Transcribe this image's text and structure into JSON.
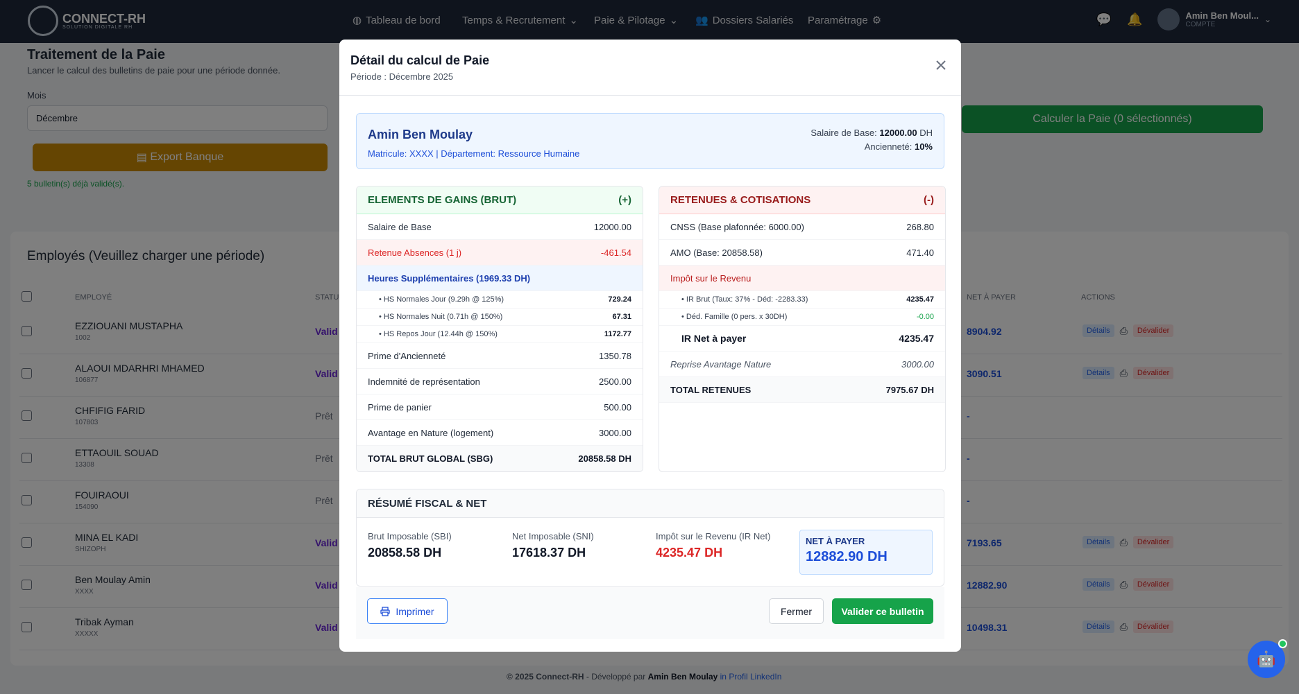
{
  "nav": {
    "brand": "CONNECT-RH",
    "brand_sub": "SOLUTION DIGITALE RH",
    "items": [
      "Tableau de bord",
      "Temps & Recrutement",
      "Paie & Pilotage",
      "Dossiers Salariés",
      "Paramétrage"
    ],
    "user_name": "Amin Ben Moul...",
    "user_role": "COMPTE"
  },
  "page": {
    "title": "Traitement de la Paie",
    "subtitle": "Lancer le calcul des bulletins de paie pour une période donnée.",
    "mois_label": "Mois",
    "mois_value": "Décembre",
    "export_label": "Export Banque",
    "validated_text": "5 bulletin(s) déjà validé(s).",
    "calc_label": "Calculer la Paie (0 sélectionnés)",
    "employees_title": "Employés (Veuillez charger une période)",
    "columns": {
      "employe": "EMPLOYÉ",
      "statut": "STATU",
      "net": "NET À PAYER",
      "actions": "ACTIONS"
    }
  },
  "employees": [
    {
      "name": "EZZIOUANI MUSTAPHA",
      "code": "1002",
      "status": "Valid",
      "net": "8904.92",
      "actions": true
    },
    {
      "name": "ALAOUI MDARHRI MHAMED",
      "code": "106877",
      "status": "Valid",
      "net": "3090.51",
      "actions": true
    },
    {
      "name": "CHFIFIG FARID",
      "code": "107803",
      "status": "Prêt",
      "net": "-",
      "actions": false
    },
    {
      "name": "ETTAOUIL SOUAD",
      "code": "13308",
      "status": "Prêt",
      "net": "-",
      "actions": false
    },
    {
      "name": "FOUIRAOUI",
      "code": "154090",
      "status": "Prêt",
      "net": "-",
      "actions": false
    },
    {
      "name": "MINA EL KADI",
      "code": "SHIZOPH",
      "status": "Valid",
      "net": "7193.65",
      "actions": true
    },
    {
      "name": "Ben Moulay Amin",
      "code": "XXXX",
      "status": "Valid",
      "net": "12882.90",
      "actions": true
    },
    {
      "name": "Tribak Ayman",
      "code": "XXXXX",
      "status": "Valid",
      "net": "10498.31",
      "actions": true
    }
  ],
  "row_actions": {
    "details": "Détails",
    "devalider": "Dévalider"
  },
  "footer": {
    "copy": "© 2025 Connect-RH",
    "dev": " - Développé par ",
    "author": "Amin Ben Moulay",
    "linkedin": "Profil LinkedIn"
  },
  "modal": {
    "title": "Détail du calcul de Paie",
    "period": "Période : Décembre 2025",
    "employee": {
      "name": "Amin Ben Moulay",
      "meta": "Matricule: XXXX | Département: Ressource Humaine",
      "base_label": "Salaire de Base: ",
      "base_value": "12000.00",
      "base_unit": " DH",
      "anc_label": "Ancienneté: ",
      "anc_value": "10%"
    },
    "gains": {
      "title": "ELEMENTS DE GAINS (BRUT)",
      "sign": "(+)",
      "salaire_label": "Salaire de Base",
      "salaire_value": "12000.00",
      "absence_label": "Retenue Absences (1 j)",
      "absence_value": "-461.54",
      "hs_label": "Heures Supplémentaires (1969.33 DH)",
      "hs": [
        {
          "label": "• HS Normales Jour (9.29h @ 125%)",
          "value": "729.24"
        },
        {
          "label": "• HS Normales Nuit (0.71h @ 150%)",
          "value": "67.31"
        },
        {
          "label": "• HS Repos Jour (12.44h @ 150%)",
          "value": "1172.77"
        }
      ],
      "items": [
        {
          "label": "Prime d'Ancienneté",
          "value": "1350.78"
        },
        {
          "label": "Indemnité de représentation",
          "value": "2500.00"
        },
        {
          "label": "Prime de panier",
          "value": "500.00"
        },
        {
          "label": "Avantage en Nature (logement)",
          "value": "3000.00"
        }
      ],
      "total_label": "TOTAL BRUT GLOBAL (SBG)",
      "total_value": "20858.58 DH"
    },
    "retenues": {
      "title": "RETENUES & COTISATIONS",
      "sign": "(-)",
      "cnss_label": "CNSS (Base plafonnée: 6000.00)",
      "cnss_value": "268.80",
      "amo_label": "AMO (Base: 20858.58)",
      "amo_value": "471.40",
      "ir_label": "Impôt sur le Revenu",
      "ir_brut_label": "• IR Brut (Taux: 37% - Déd: -2283.33)",
      "ir_brut_value": "4235.47",
      "ded_label": "• Déd. Famille (0 pers. x 30DH)",
      "ded_value": "-0.00",
      "irnet_label": "IR Net à payer",
      "irnet_value": "4235.47",
      "reprise_label": "Reprise Avantage Nature",
      "reprise_value": "3000.00",
      "total_label": "TOTAL RETENUES",
      "total_value": "7975.67 DH"
    },
    "fiscal": {
      "title": "RÉSUMÉ FISCAL & NET",
      "sbi_label": "Brut Imposable (SBI)",
      "sbi_value": "20858.58 DH",
      "sni_label": "Net Imposable (SNI)",
      "sni_value": "17618.37 DH",
      "ir_label": "Impôt sur le Revenu (IR Net)",
      "ir_value": "4235.47 DH",
      "net_label": "NET À PAYER",
      "net_value": "12882.90 DH"
    },
    "buttons": {
      "print": "Imprimer",
      "close": "Fermer",
      "validate": "Valider ce bulletin"
    }
  }
}
